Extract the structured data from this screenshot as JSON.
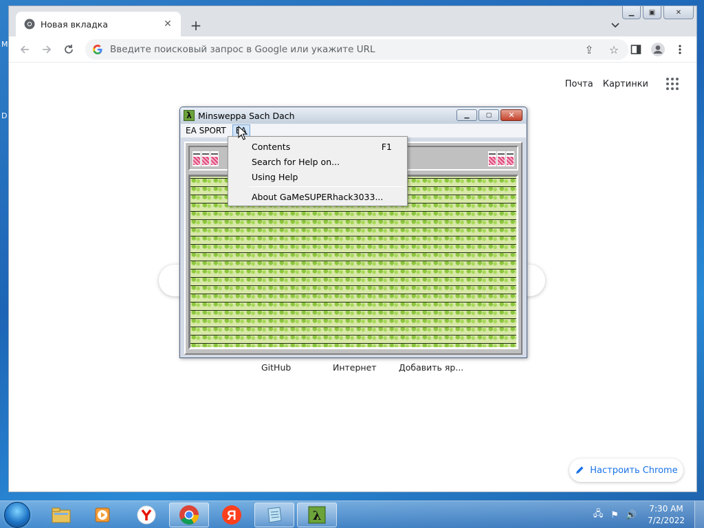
{
  "desktop": {
    "left_text_1": "M",
    "left_text_2": "D"
  },
  "chrome": {
    "tab_title": "Новая вкладка",
    "tab_close": "✕",
    "new_tab": "+",
    "omnibox_placeholder": "Введите поисковый запрос в Google или укажите URL",
    "ntp_links": {
      "mail": "Почта",
      "images": "Картинки"
    },
    "shortcuts": [
      "GitHub",
      "Интернет",
      "Добавить яр..."
    ],
    "customize_label": "Настроить Chrome"
  },
  "minesweeper": {
    "title": "Minsweppa Sach Dach",
    "menu": [
      "EA SPORT",
      "EA"
    ],
    "dropdown": [
      {
        "label": "Contents",
        "accel": "F1"
      },
      {
        "label": "Search for Help on...",
        "accel": ""
      },
      {
        "label": "Using Help",
        "accel": ""
      },
      {
        "label": "About GaMeSUPERhack3033...",
        "accel": ""
      }
    ]
  },
  "taskbar": {
    "time": "7:30 AM",
    "date": "7/2/2022",
    "apps": [
      "explorer-icon",
      "media-player-icon",
      "yandex-browser-icon",
      "chrome-icon",
      "yandex-icon",
      "notepad-icon",
      "lambda-app-icon"
    ]
  },
  "colors": {
    "accent": "#1a73e8",
    "desktop": "#1d64b5",
    "grid_green": "#8cc63f",
    "counter_pink": "#e0457b"
  }
}
